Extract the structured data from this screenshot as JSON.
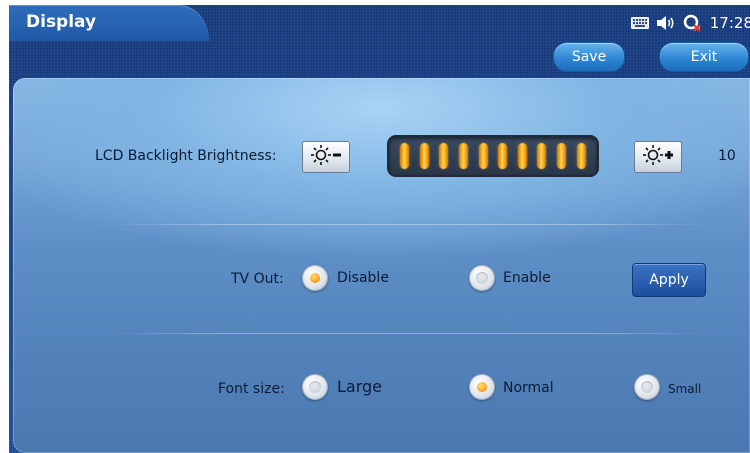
{
  "window": {
    "title": "Display"
  },
  "status_bar": {
    "icons": [
      "keyboard-icon",
      "speaker-icon",
      "network-disconnected-icon"
    ],
    "time": "17:28"
  },
  "toolbar": {
    "save_label": "Save",
    "exit_label": "Exit"
  },
  "brightness": {
    "label": "LCD Backlight Brightness:",
    "decrease_icon": "brightness-decrease-icon",
    "increase_icon": "brightness-increase-icon",
    "level": 10,
    "max_level": 10,
    "value_text": "10"
  },
  "tv_out": {
    "label": "TV Out:",
    "options": [
      {
        "label": "Disable",
        "selected": true
      },
      {
        "label": "Enable",
        "selected": false
      }
    ],
    "apply_label": "Apply"
  },
  "font_size": {
    "label": "Font size:",
    "options": [
      {
        "label": "Large",
        "selected": false
      },
      {
        "label": "Normal",
        "selected": true
      },
      {
        "label": "Small",
        "selected": false
      }
    ]
  },
  "colors": {
    "accent": "#ffa51e",
    "panel": "#7fb4e3",
    "background": "#1b3f82"
  }
}
